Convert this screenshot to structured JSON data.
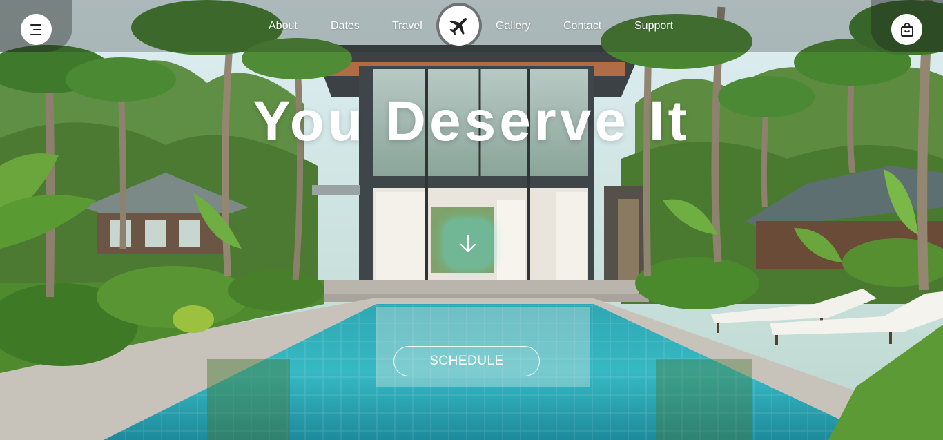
{
  "header": {
    "menu_icon": "hamburger-menu-icon",
    "cart_icon": "shopping-bag-icon",
    "logo_icon": "airplane-icon",
    "nav": [
      {
        "label": "About"
      },
      {
        "label": "Dates"
      },
      {
        "label": "Travel"
      },
      {
        "label": "Gallery"
      },
      {
        "label": "Contact"
      },
      {
        "label": "Support"
      }
    ]
  },
  "hero": {
    "headline": "You Deserve It",
    "scroll_icon": "arrow-down-icon",
    "cta_label": "SCHEDULE"
  },
  "colors": {
    "accent_cyan": "#5cdde6",
    "text_white": "#ffffff",
    "icon_dark": "#222222"
  }
}
